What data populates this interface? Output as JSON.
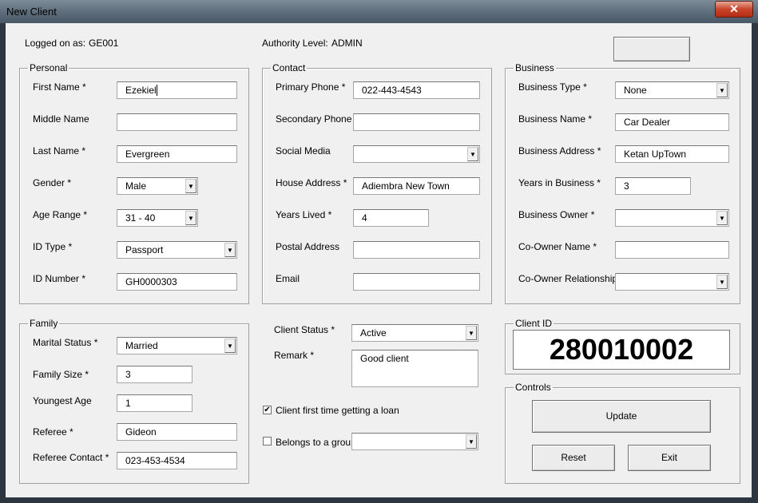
{
  "window": {
    "title": "New Client",
    "close_label": "✕"
  },
  "header": {
    "logged_on_label": "Logged on as:",
    "logged_on_value": "GE001",
    "authority_label": "Authority Level:",
    "authority_value": "ADMIN"
  },
  "personal": {
    "legend": "Personal",
    "first_name_label": "First Name *",
    "first_name": "Ezekiel",
    "middle_name_label": "Middle Name",
    "middle_name": "",
    "last_name_label": "Last Name *",
    "last_name": "Evergreen",
    "gender_label": "Gender *",
    "gender": "Male",
    "age_range_label": "Age Range *",
    "age_range": "31 - 40",
    "id_type_label": "ID Type *",
    "id_type": "Passport",
    "id_number_label": "ID Number *",
    "id_number": "GH0000303"
  },
  "contact": {
    "legend": "Contact",
    "primary_phone_label": "Primary Phone *",
    "primary_phone": "022-443-4543",
    "secondary_phone_label": "Secondary Phone",
    "secondary_phone": "",
    "social_media_label": "Social Media",
    "social_media": "",
    "house_address_label": "House Address *",
    "house_address": "Adiembra New Town",
    "years_lived_label": "Years Lived *",
    "years_lived": "4",
    "postal_address_label": "Postal Address",
    "postal_address": "",
    "email_label": "Email",
    "email": ""
  },
  "business": {
    "legend": "Business",
    "type_label": "Business Type *",
    "type": "None",
    "name_label": "Business Name *",
    "name": "Car Dealer",
    "address_label": "Business Address *",
    "address": "Ketan UpTown",
    "years_label": "Years in Business *",
    "years": "3",
    "owner_label": "Business Owner *",
    "owner": "",
    "co_owner_name_label": "Co-Owner Name *",
    "co_owner_name": "",
    "co_owner_rel_label": "Co-Owner Relationship *",
    "co_owner_rel": ""
  },
  "family": {
    "legend": "Family",
    "marital_label": "Marital Status *",
    "marital": "Married",
    "size_label": "Family Size *",
    "size": "3",
    "youngest_label": "Youngest Age",
    "youngest": "1",
    "referee_label": "Referee *",
    "referee": "Gideon",
    "referee_contact_label": "Referee Contact *",
    "referee_contact": "023-453-4534"
  },
  "status": {
    "client_status_label": "Client Status *",
    "client_status": "Active",
    "remark_label": "Remark *",
    "remark": "Good client",
    "first_loan_label": "Client first time getting a loan",
    "first_loan_checked": true,
    "group_label": "Belongs to a group",
    "group_checked": false,
    "group": ""
  },
  "client_id": {
    "legend": "Client ID",
    "value": "280010002"
  },
  "controls": {
    "legend": "Controls",
    "update_label": "Update",
    "reset_label": "Reset",
    "exit_label": "Exit"
  }
}
